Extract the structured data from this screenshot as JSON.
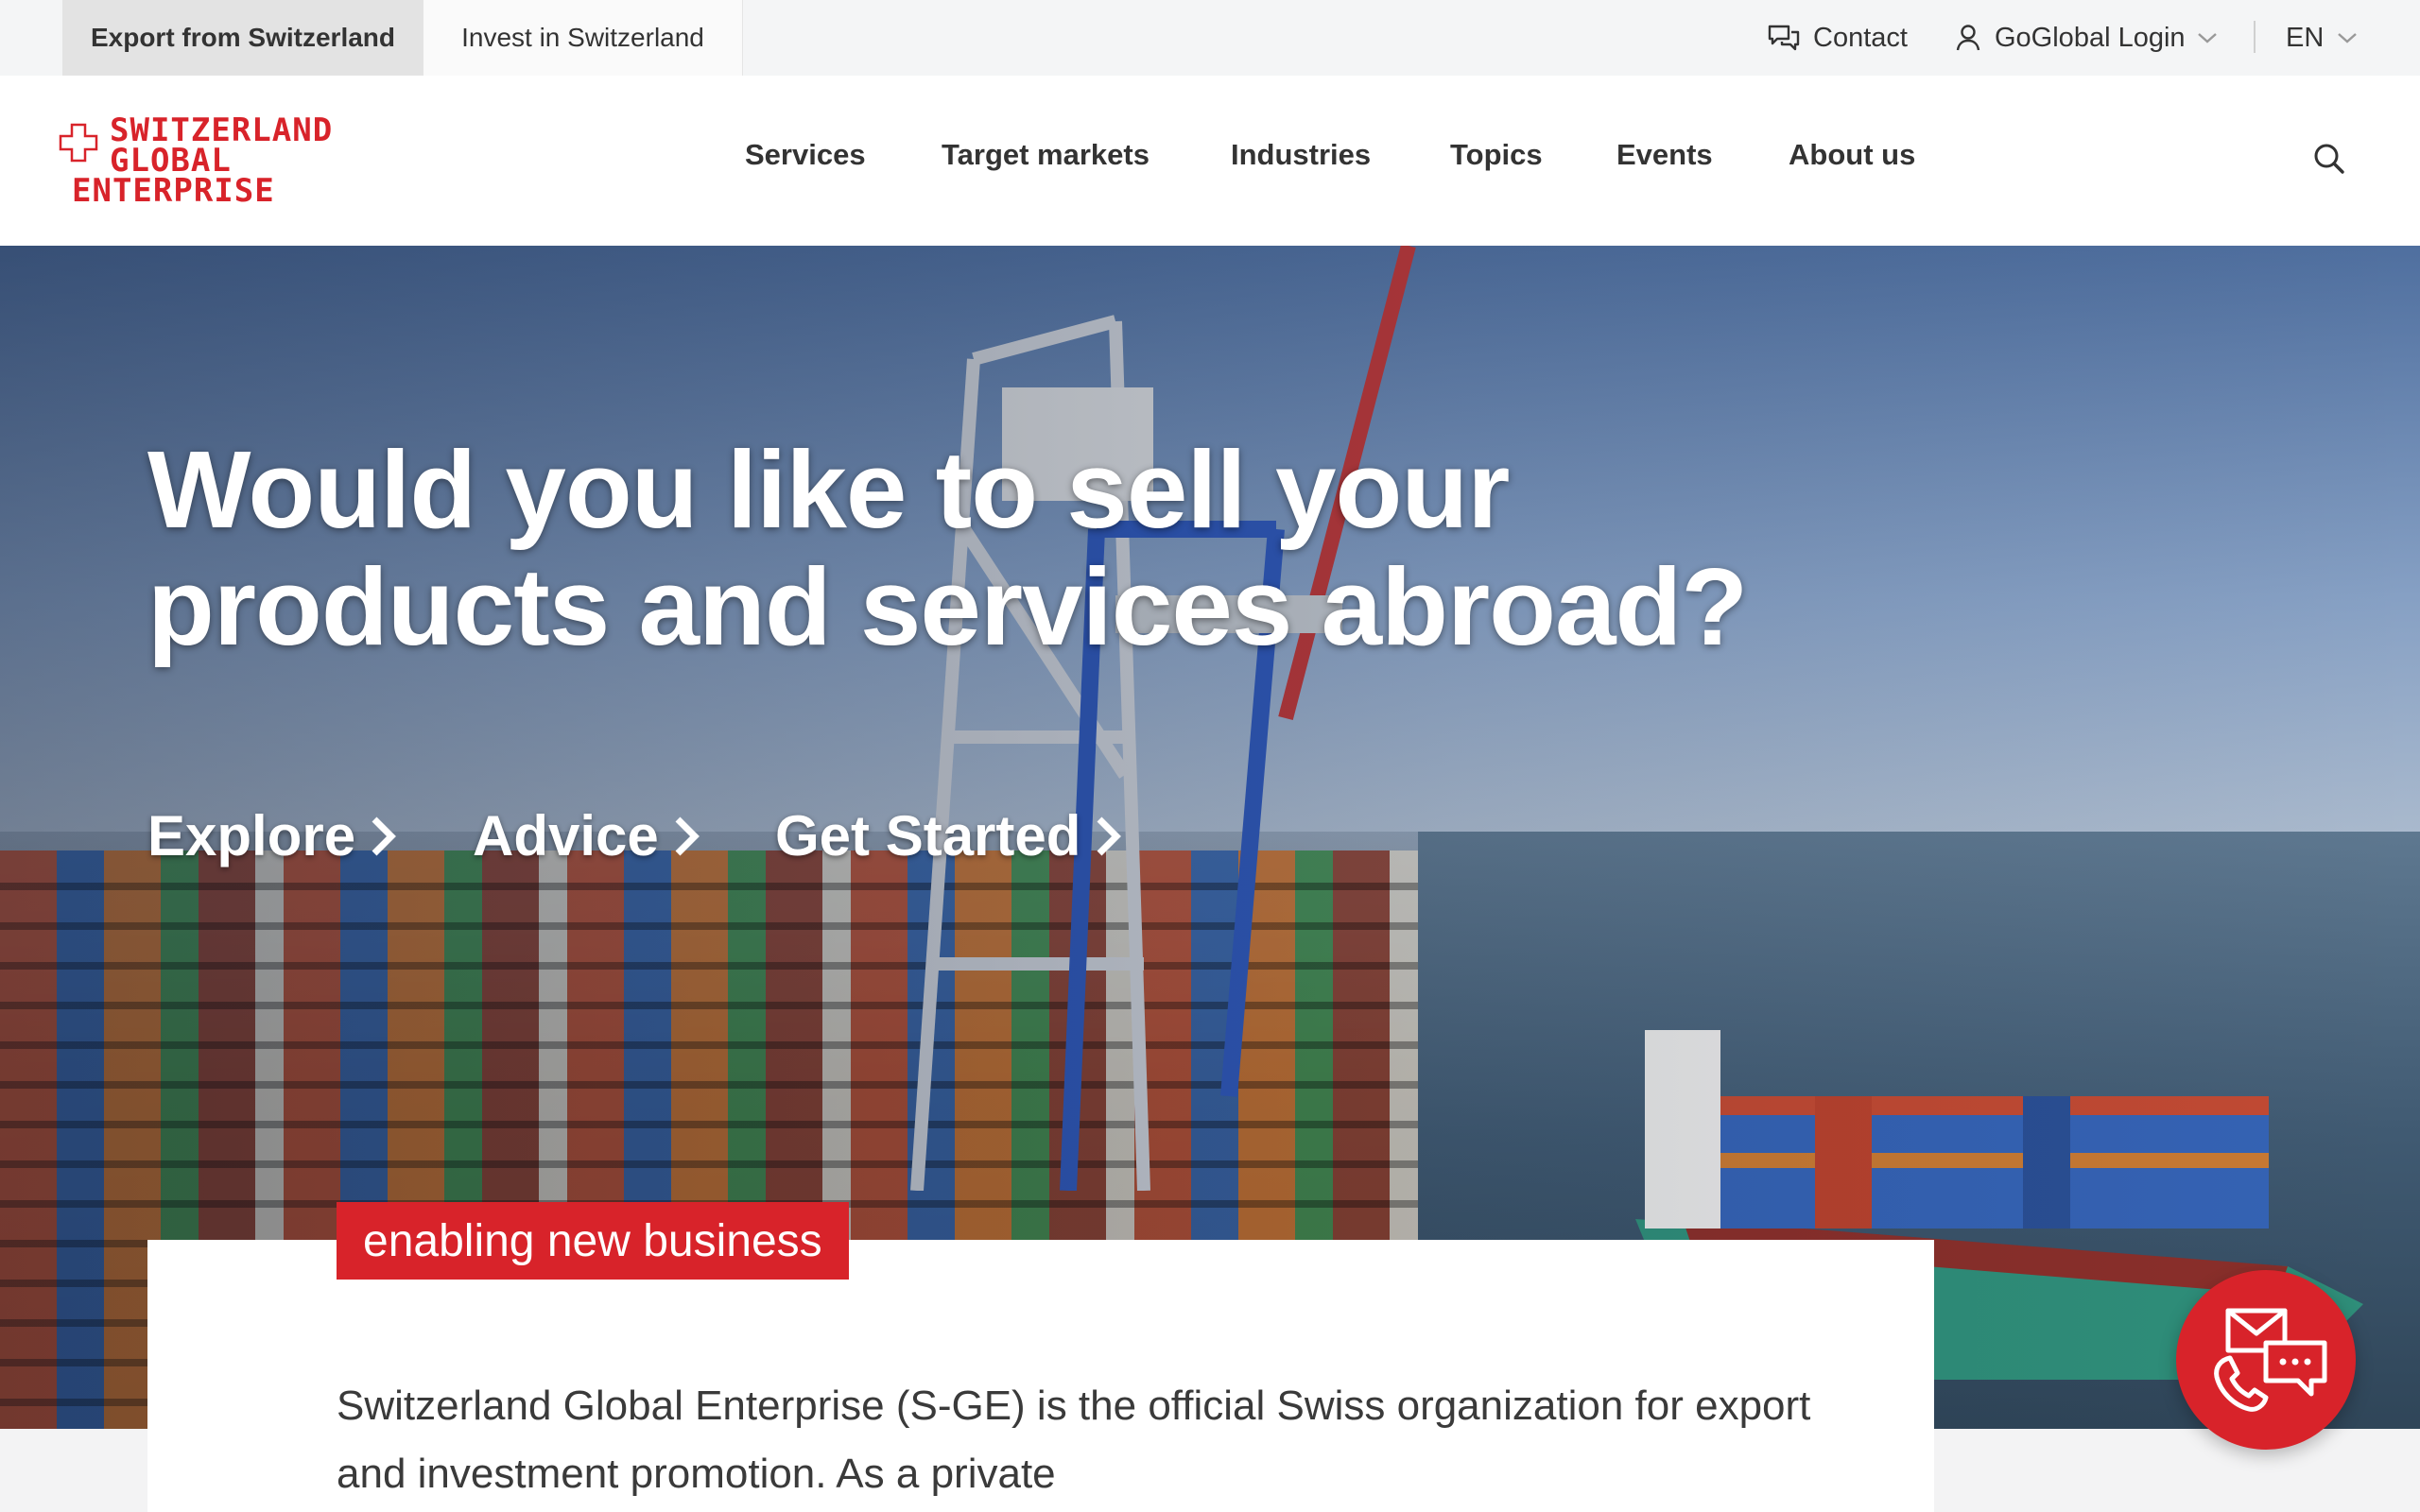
{
  "utility_bar": {
    "site_tabs": [
      {
        "label": "Export from Switzerland",
        "active": true
      },
      {
        "label": "Invest in Switzerland",
        "active": false
      }
    ],
    "contact": {
      "label": "Contact",
      "icon": "chat-bubbles-icon"
    },
    "login": {
      "label": "GoGlobal Login",
      "icon": "user-icon"
    },
    "language": {
      "label": "EN"
    }
  },
  "header": {
    "logo": {
      "lines": [
        "SWITZERLAND",
        "GLOBAL",
        "ENTERPRISE"
      ],
      "color": "#d8232a"
    },
    "nav": [
      {
        "label": "Services"
      },
      {
        "label": "Target markets"
      },
      {
        "label": "Industries"
      },
      {
        "label": "Topics"
      },
      {
        "label": "Events"
      },
      {
        "label": "About us"
      }
    ],
    "search_icon": "search-icon"
  },
  "hero": {
    "title_lines": [
      "Would you like to sell your",
      "products and services abroad?"
    ],
    "links": [
      {
        "label": "Explore"
      },
      {
        "label": "Advice"
      },
      {
        "label": "Get Started"
      }
    ]
  },
  "intro": {
    "tagline": "enabling new business",
    "text": "Switzerland Global Enterprise (S-GE) is the official Swiss organization for export and investment promotion. As a private"
  },
  "fab": {
    "icon": "mail-phone-chat-icon"
  },
  "colors": {
    "accent": "#d8232a",
    "text": "#333333",
    "utility_bg": "#f4f5f6"
  }
}
